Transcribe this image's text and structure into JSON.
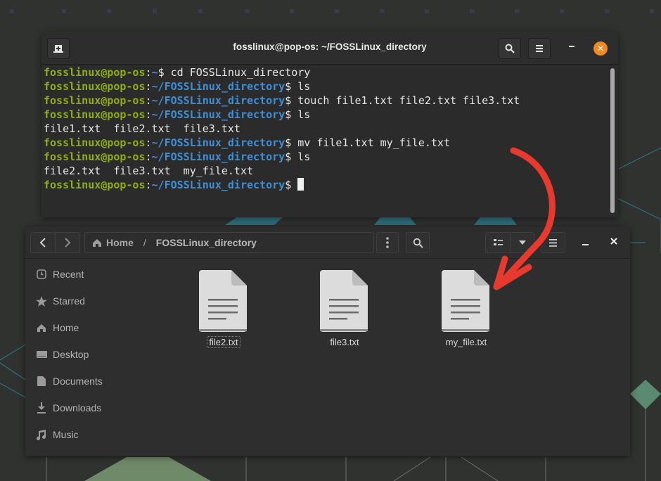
{
  "colors": {
    "accent_orange": "#f08a24",
    "prompt_user": "#8fae12",
    "prompt_path": "#3f8fd8",
    "annotation_arrow": "#e8392e"
  },
  "terminal": {
    "title": "fosslinux@pop-os: ~/FOSSLinux_directory",
    "new_tab_icon": "new-tab-icon",
    "search_icon": "search-icon",
    "menu_icon": "hamburger-menu-icon",
    "minimize_icon": "minimize-icon",
    "close_icon": "close-icon",
    "lines": [
      {
        "user": "fosslinux@pop-os",
        "sep": ":",
        "path": "~",
        "sign": "$ ",
        "cmd": "cd FOSSLinux_directory"
      },
      {
        "user": "fosslinux@pop-os",
        "sep": ":",
        "path": "~/FOSSLinux_directory",
        "sign": "$ ",
        "cmd": "ls"
      },
      {
        "user": "fosslinux@pop-os",
        "sep": ":",
        "path": "~/FOSSLinux_directory",
        "sign": "$ ",
        "cmd": "touch file1.txt file2.txt file3.txt"
      },
      {
        "user": "fosslinux@pop-os",
        "sep": ":",
        "path": "~/FOSSLinux_directory",
        "sign": "$ ",
        "cmd": "ls"
      },
      {
        "output": "file1.txt  file2.txt  file3.txt"
      },
      {
        "user": "fosslinux@pop-os",
        "sep": ":",
        "path": "~/FOSSLinux_directory",
        "sign": "$ ",
        "cmd": "mv file1.txt my_file.txt"
      },
      {
        "user": "fosslinux@pop-os",
        "sep": ":",
        "path": "~/FOSSLinux_directory",
        "sign": "$ ",
        "cmd": "ls"
      },
      {
        "output": "file2.txt  file3.txt  my_file.txt"
      },
      {
        "user": "fosslinux@pop-os",
        "sep": ":",
        "path": "~/FOSSLinux_directory",
        "sign": "$ ",
        "cmd": ""
      }
    ]
  },
  "files_window": {
    "breadcrumb": {
      "home": "Home",
      "separator": "/",
      "current": "FOSSLinux_directory"
    },
    "sidebar": [
      {
        "label": "Recent",
        "icon": "clock-icon"
      },
      {
        "label": "Starred",
        "icon": "star-icon"
      },
      {
        "label": "Home",
        "icon": "home-icon"
      },
      {
        "label": "Desktop",
        "icon": "desktop-icon"
      },
      {
        "label": "Documents",
        "icon": "document-icon"
      },
      {
        "label": "Downloads",
        "icon": "download-icon"
      },
      {
        "label": "Music",
        "icon": "music-icon"
      }
    ],
    "files": [
      {
        "name": "file2.txt",
        "selected": true
      },
      {
        "name": "file3.txt",
        "selected": false
      },
      {
        "name": "my_file.txt",
        "selected": false
      }
    ]
  }
}
